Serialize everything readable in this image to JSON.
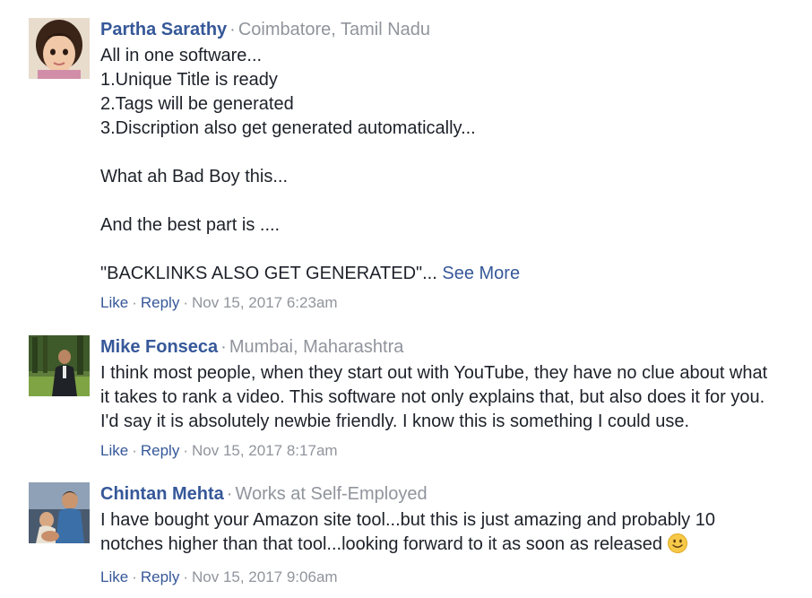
{
  "comments": [
    {
      "author": "Partha Sarathy",
      "meta": "Coimbatore, Tamil Nadu",
      "lines": [
        "All in one software...",
        "1.Unique Title is ready",
        "2.Tags will be generated",
        "3.Discription also get generated automatically...",
        "",
        "What ah Bad Boy this...",
        "",
        "And the best part is ....",
        "",
        "\"BACKLINKS ALSO GET GENERATED\"..."
      ],
      "see_more": "See More",
      "like": "Like",
      "reply": "Reply",
      "time": "Nov 15, 2017 6:23am"
    },
    {
      "author": "Mike Fonseca",
      "meta": "Mumbai, Maharashtra",
      "lines": [
        "I think most people, when they start out with YouTube, they have no clue about what",
        "it takes to rank a video. This software not only explains that, but also does it for you.",
        "I'd say it is absolutely newbie friendly. I know this is something I could use."
      ],
      "like": "Like",
      "reply": "Reply",
      "time": "Nov 15, 2017 8:17am"
    },
    {
      "author": "Chintan Mehta",
      "meta": "Works at Self-Employed",
      "lines": [
        "I have bought your Amazon site tool...but this is just amazing and probably 10",
        "notches higher than that tool...looking forward to it as soon as released"
      ],
      "emoji": "smile-emoji",
      "like": "Like",
      "reply": "Reply",
      "time": "Nov 15, 2017 9:06am"
    }
  ],
  "separator": "·",
  "colors": {
    "link": "#365899",
    "meta": "#90949c",
    "text": "#1d2129"
  }
}
